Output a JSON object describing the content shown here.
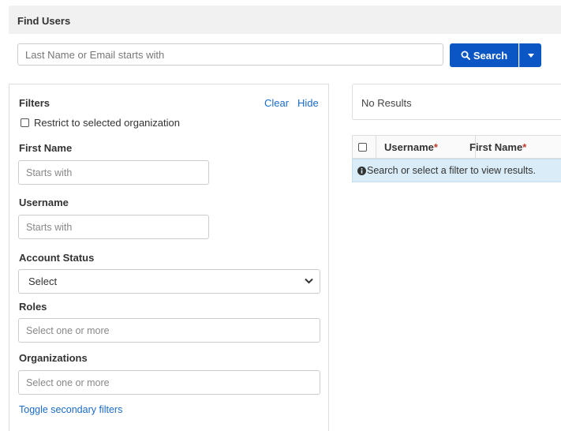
{
  "header": {
    "title": "Find Users"
  },
  "search": {
    "placeholder": "Last Name or Email starts with",
    "button_label": "Search"
  },
  "filters": {
    "title": "Filters",
    "clear_label": "Clear",
    "hide_label": "Hide",
    "restrict_label": "Restrict to selected organization",
    "first_name": {
      "label": "First Name",
      "placeholder": "Starts with"
    },
    "username": {
      "label": "Username",
      "placeholder": "Starts with"
    },
    "account_status": {
      "label": "Account Status",
      "value": "Select"
    },
    "roles": {
      "label": "Roles",
      "placeholder": "Select one or more"
    },
    "organizations": {
      "label": "Organizations",
      "placeholder": "Select one or more"
    },
    "toggle_label": "Toggle secondary filters"
  },
  "results": {
    "status_text": "No Results",
    "columns": [
      "Username",
      "First Name"
    ],
    "required_mark": "*",
    "info_message": "Search or select a filter to view results."
  },
  "colors": {
    "primary": "#0a56c4",
    "link": "#1a6bc8",
    "info_bg": "#d9ecf7",
    "required": "#c0392b"
  }
}
